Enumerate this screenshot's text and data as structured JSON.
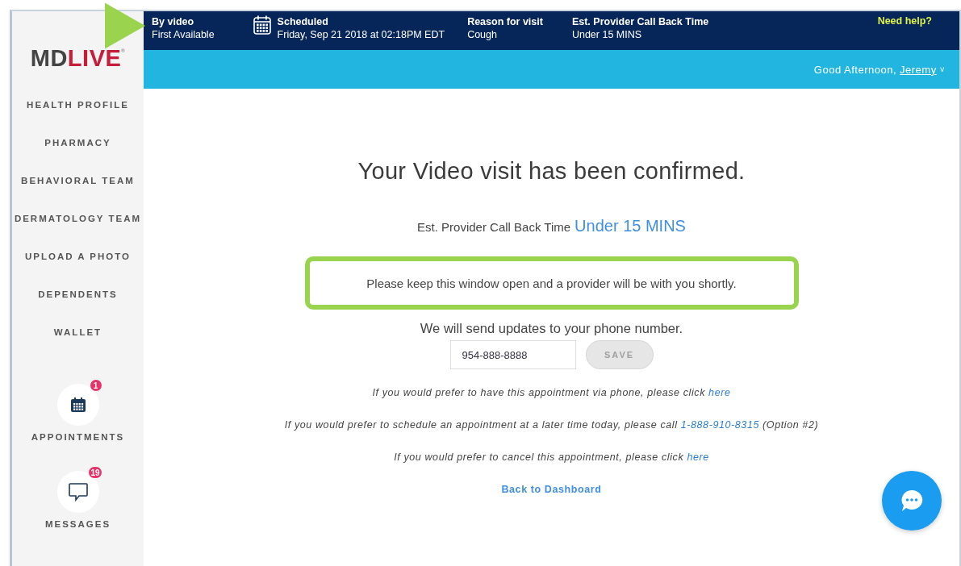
{
  "logo": {
    "part_1": "MD",
    "part_2": "LIVE",
    "mark": "®"
  },
  "visit_bar": {
    "items": [
      {
        "kind": "plain",
        "title": "By video",
        "value": "First Available"
      },
      {
        "kind": "calendar",
        "title": "Scheduled",
        "value": "Friday, Sep 21 2018 at 02:18PM EDT"
      },
      {
        "kind": "plain",
        "title": "Reason for visit",
        "value": "Cough"
      },
      {
        "kind": "plain",
        "title": "Est. Provider Call Back Time",
        "value": "Under 15 MINS"
      }
    ],
    "help_link": "Need help?"
  },
  "greeting": {
    "text": "Good Afternoon,",
    "name": "Jeremy",
    "caret": "˅"
  },
  "sidebar": {
    "items": [
      {
        "label": "HEALTH PROFILE"
      },
      {
        "label": "PHARMACY"
      },
      {
        "label": "BEHAVIORAL TEAM"
      },
      {
        "label": "DERMATOLOGY TEAM"
      },
      {
        "label": "UPLOAD A PHOTO"
      },
      {
        "label": "DEPENDENTS"
      },
      {
        "label": "WALLET"
      }
    ],
    "icon_items": [
      {
        "kind": "calendar",
        "label": "APPOINTMENTS",
        "badge": "1"
      },
      {
        "kind": "chat",
        "label": "MESSAGES",
        "badge": "19"
      }
    ]
  },
  "main": {
    "heading": "Your Video visit has been confirmed.",
    "callback": {
      "label": "Est. Provider Call Back Time",
      "value": "Under 15 MINS"
    },
    "notice": "Please keep this window open and a provider will be with you shortly.",
    "phone_prompt": "We will send updates to your phone number.",
    "phone_field": {
      "value": "954-888-8888"
    },
    "save_button": {
      "label": "SAVE",
      "disabled": true
    },
    "options": [
      {
        "before": "If you would prefer to have this appointment via phone, please click ",
        "link": "here"
      },
      {
        "before": "If you would prefer to schedule an appointment at a later time today, please call ",
        "link": "1-888-910-8315",
        "after": " (Option #2)"
      },
      {
        "before": "If you would prefer to cancel this appointment, please click ",
        "link": "here"
      }
    ],
    "dashboard_link": "Back to Dashboard"
  },
  "annotations": {
    "pointer_arrow": true,
    "highlight_notice": true
  }
}
